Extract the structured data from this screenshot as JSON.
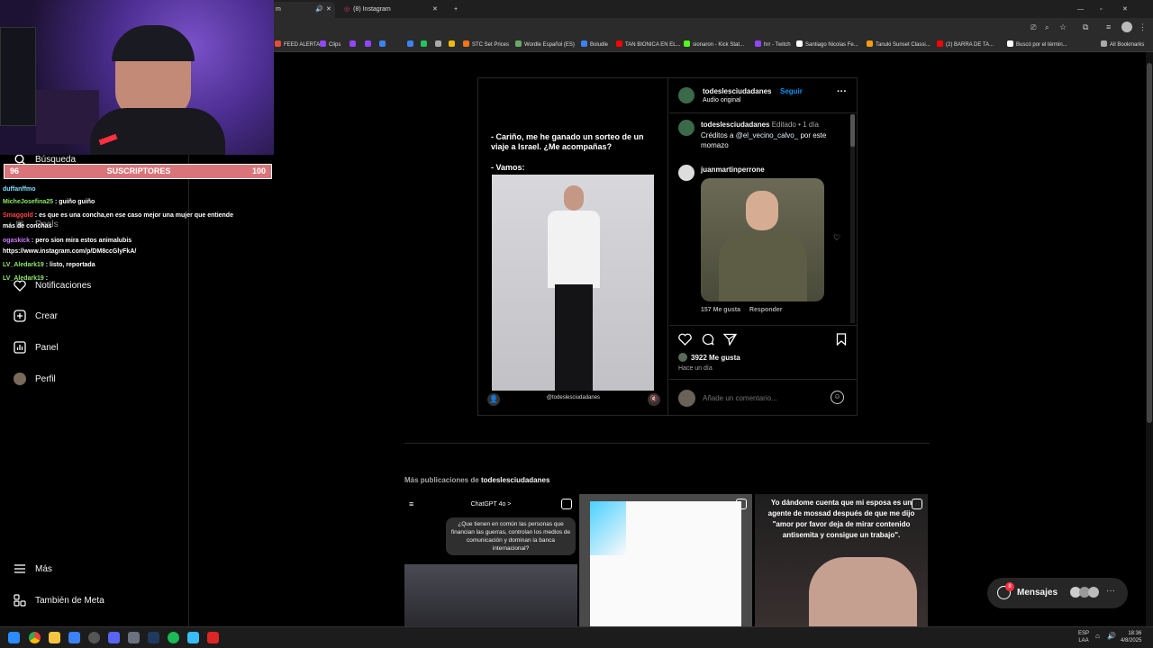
{
  "browser": {
    "tabs": [
      {
        "title": "m"
      },
      {
        "title": "(8) Instagram"
      }
    ],
    "bookmarks": [
      {
        "label": "FEED ALERTAS",
        "color": "#e74c3c"
      },
      {
        "label": "Clips",
        "color": "#9146ff"
      },
      {
        "label": "",
        "color": "#9146ff"
      },
      {
        "label": "",
        "color": "#9146ff"
      },
      {
        "label": "",
        "color": "#3b82f6"
      },
      {
        "label": "",
        "color": "#3b82f6"
      },
      {
        "label": "",
        "color": "#22c55e"
      },
      {
        "label": "",
        "color": "#aaa"
      },
      {
        "label": "",
        "color": "#f0b90b"
      },
      {
        "label": "STC Set Prices",
        "color": "#f97316"
      },
      {
        "label": "Wordle Español (ES)",
        "color": "#6aaa64"
      },
      {
        "label": "Boludle",
        "color": "#3b82f6"
      },
      {
        "label": "TAN BIONICA EN EL...",
        "color": "#ff0000"
      },
      {
        "label": "sionaron - Kick Stat...",
        "color": "#53fc18"
      },
      {
        "label": "hrr - Twitch",
        "color": "#9146ff"
      },
      {
        "label": "Santiago Nicolas Fe...",
        "color": "#fff"
      },
      {
        "label": "Tanuki Sunset Classi...",
        "color": "#f59e0b"
      },
      {
        "label": "(2) BARRA DE TA...",
        "color": "#ff0000"
      },
      {
        "label": "Buscó por el términ...",
        "color": "#fff"
      },
      {
        "label": "All Bookmarks",
        "color": "#aaa"
      }
    ]
  },
  "nav": {
    "items": [
      {
        "label": "Búsqueda",
        "icon": "search-icon"
      },
      {
        "label": "Reels",
        "icon": "reels-icon"
      },
      {
        "label": "Notificaciones",
        "icon": "heart-icon"
      },
      {
        "label": "Crear",
        "icon": "plus-square-icon"
      },
      {
        "label": "Panel",
        "icon": "chart-icon"
      },
      {
        "label": "Perfil",
        "icon": "avatar-icon"
      },
      {
        "label": "Más",
        "icon": "menu-icon"
      },
      {
        "label": "También de Meta",
        "icon": "meta-icon"
      }
    ]
  },
  "overlay": {
    "subs_start": "96",
    "subs_label": "SUSCRIPTORES",
    "subs_end": "100",
    "chat": [
      {
        "user": "duffanffmo",
        "text": "",
        "color": "#7ee0ff"
      },
      {
        "user": "MicheJosefina25",
        "text": ": guiño guiño",
        "color": "#8ee86b"
      },
      {
        "user": "Smaggold",
        "text": ": es que es una concha,en ese caso mejor una mujer que entiende",
        "color": "#ff4444"
      },
      {
        "user": "",
        "text": "más de conchas",
        "color": "#fff"
      },
      {
        "user": "ogaskick",
        "text": ": pero sion mira estos animalubis",
        "color": "#d07bff"
      },
      {
        "user": "",
        "text": "https://www.instagram.com/p/DM8ccGlyFkA/",
        "color": "#fff"
      },
      {
        "user": "LV_Aledark19",
        "text": ": listo, reportada",
        "color": "#8ee86b"
      },
      {
        "user": "LV_Aledark19",
        "text": ":",
        "color": "#8ee86b"
      }
    ]
  },
  "post": {
    "media_text_1": "- Cariño, me he ganado un sorteo de un viaje a Israel. ¿Me acompañas?",
    "media_text_2": "- Vamos:",
    "media_handle": "@todeslesciudadanes",
    "author": "todeslesciudadanes",
    "follow": "Seguir",
    "audio": "Audio original",
    "caption_author": "todeslesciudadanes",
    "caption_edited": "Editado",
    "caption_time": "1 día",
    "caption_text_1": "Créditos a",
    "caption_mention": "@el_vecino_calvo_",
    "caption_text_2": "por este momazo",
    "comment_author": "juanmartinperrone",
    "comment_likes": "157 Me gusta",
    "comment_reply": "Responder",
    "likes": "3922 Me gusta",
    "posted": "Hace un día",
    "add_comment_placeholder": "Añade un comentario..."
  },
  "more": {
    "prefix": "Más publicaciones de",
    "account": "todeslesciudadanes",
    "thumbs": [
      {
        "header": "ChatGPT 4o >",
        "text": "¿Que tienen en común las personas que financian las guerras, controlan los medios de comunicación y dominan la banca internacional?"
      },
      {
        "header": "",
        "text": ""
      },
      {
        "header": "",
        "text": "Yo dándome cuenta que mi esposa es un agente de mossad después de que me dijo \"amor por favor deja de mirar contenido antisemita y consigue un trabajo\"."
      }
    ]
  },
  "messages": {
    "label": "Mensajes",
    "badge": "8"
  },
  "taskbar": {
    "lang_top": "ESP",
    "lang_bottom": "LAA",
    "time": "18:36",
    "date": "4/8/2025"
  }
}
